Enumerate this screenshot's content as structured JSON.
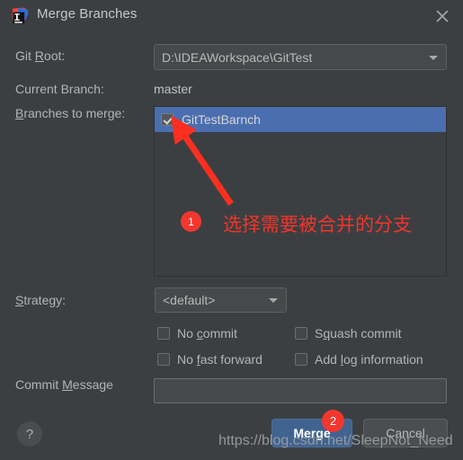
{
  "window": {
    "title": "Merge Branches",
    "app_icon": "intellij-idea-icon",
    "close_icon": "close-icon",
    "background_color": "#3c3f41"
  },
  "form": {
    "git_root": {
      "label": "Git Root:",
      "mnemonic": "R",
      "value": "D:\\IDEAWorkspace\\GitTest",
      "dropdown_icon": "chevron-down-icon"
    },
    "current_branch": {
      "label": "Current Branch:",
      "value": "master"
    },
    "branches_to_merge": {
      "label": "Branches to merge:",
      "mnemonic": "B",
      "items": [
        {
          "name": "GitTestBarnch",
          "checked": true,
          "selected": true
        }
      ],
      "selection_color": "#4b6eaf"
    },
    "strategy": {
      "label": "Strategy:",
      "mnemonic": "S",
      "value": "<default>",
      "dropdown_icon": "chevron-down-icon"
    },
    "options": [
      {
        "label": "No commit",
        "mnemonic": "c",
        "checked": false
      },
      {
        "label": "Squash commit",
        "mnemonic": "q",
        "checked": false
      },
      {
        "label": "No fast forward",
        "mnemonic": "f",
        "checked": false
      },
      {
        "label": "Add log information",
        "mnemonic": "l",
        "checked": false
      }
    ],
    "commit_message": {
      "label": "Commit Message",
      "mnemonic": "M",
      "value": "",
      "placeholder": ""
    }
  },
  "footer": {
    "help_label": "?",
    "merge_label": "Merge",
    "cancel_label": "Cancel",
    "merge_color": "#41638f"
  },
  "annotations": {
    "badge_1": "1",
    "badge_2": "2",
    "note_1": "选择需要被合并的分支",
    "accent_color": "#f0352c",
    "arrow": "red-arrow-pointing-to-checkbox"
  },
  "watermark": "https://blog.csdn.net/SleepNot_Need"
}
